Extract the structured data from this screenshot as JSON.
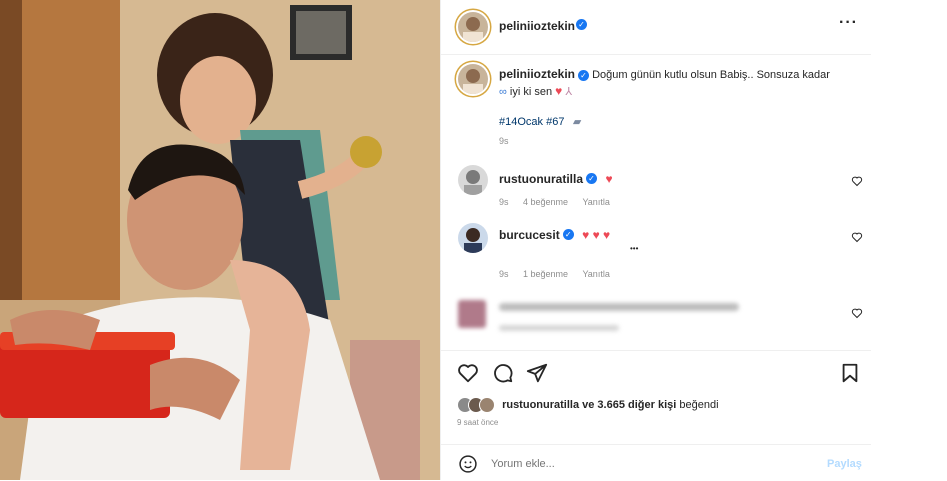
{
  "post": {
    "author": "peliniioztekin",
    "more_icon": "more-horizontal-icon",
    "caption_text": "Doğum günün kutlu olsun Babiş.. Sonsuza kadar",
    "caption_line2": "iyi ki sen",
    "hashtags": "#14Ocak #67",
    "caption_time": "9s"
  },
  "comments": [
    {
      "user": "rustuonuratilla",
      "text": "♥",
      "time": "9s",
      "likes": "4 beğenme",
      "reply": "Yanıtla"
    },
    {
      "user": "burcucesit",
      "text": "♥ ♥ ♥",
      "time": "9s",
      "likes": "1 beğenme",
      "reply": "Yanıtla",
      "more": "•••"
    }
  ],
  "likes": {
    "liked_by_user": "rustuonuratilla",
    "others_text": "ve 3.665 diğer kişi",
    "suffix": "beğendi",
    "timestamp": "9 saat önce"
  },
  "comment_box": {
    "placeholder": "Yorum ekle...",
    "post_label": "Paylaş"
  },
  "colors": {
    "verified": "#1877f2",
    "heart": "#ed4956",
    "link": "#00376b",
    "post_button": "#b3dbff"
  }
}
